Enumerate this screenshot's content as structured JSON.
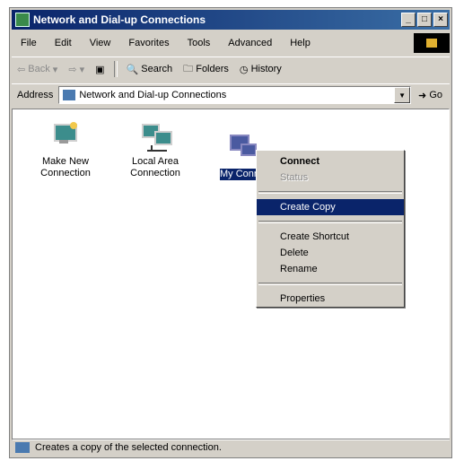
{
  "window": {
    "title": "Network and Dial-up Connections",
    "controls": {
      "minimize": "_",
      "maximize": "□",
      "close": "×"
    }
  },
  "menubar": [
    "File",
    "Edit",
    "View",
    "Favorites",
    "Tools",
    "Advanced",
    "Help"
  ],
  "toolbar": {
    "back": "Back",
    "forward": "",
    "search": "Search",
    "folders": "Folders",
    "history": "History"
  },
  "address": {
    "label": "Address",
    "value": "Network and Dial-up Connections",
    "go": "Go"
  },
  "items": [
    {
      "label1": "Make New",
      "label2": "Connection",
      "icon": "make-new-connection-icon"
    },
    {
      "label1": "Local Area",
      "label2": "Connection",
      "icon": "local-area-connection-icon"
    },
    {
      "label1": "My Conn",
      "label2": "",
      "icon": "my-connection-icon",
      "selected": true
    }
  ],
  "context_menu": {
    "items": [
      {
        "label": "Connect",
        "style": "bold"
      },
      {
        "label": "Status",
        "style": "disabled"
      },
      {
        "label": "Create Copy",
        "style": "highlighted"
      },
      {
        "label": "Create Shortcut",
        "style": "normal"
      },
      {
        "label": "Delete",
        "style": "normal"
      },
      {
        "label": "Rename",
        "style": "normal"
      },
      {
        "label": "Properties",
        "style": "normal"
      }
    ]
  },
  "status": {
    "text": "Creates a copy of the selected connection."
  },
  "colors": {
    "titlebar": "#0a246a",
    "selection": "#0a246a",
    "face": "#d4d0c8"
  }
}
